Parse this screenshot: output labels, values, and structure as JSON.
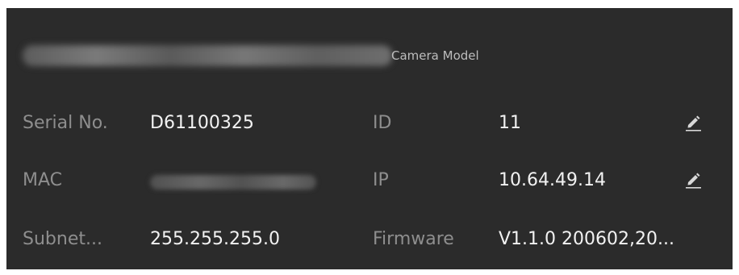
{
  "camera": {
    "model_caption": "Camera Model"
  },
  "fields": {
    "serial_label": "Serial No.",
    "serial_value": "D61100325",
    "id_label": "ID",
    "id_value": "11",
    "mac_label": "MAC",
    "ip_label": "IP",
    "ip_value": "10.64.49.14",
    "subnet_label": "Subnet...",
    "subnet_value": "255.255.255.0",
    "firmware_label": "Firmware",
    "firmware_value": "V1.1.0 200602,20..."
  },
  "icons": {
    "edit_id": "pencil-icon",
    "edit_ip": "pencil-icon"
  },
  "colors": {
    "panel_background": "#2b2b2b",
    "label_text": "#8e8e8e",
    "value_text": "#f2f2f2"
  }
}
